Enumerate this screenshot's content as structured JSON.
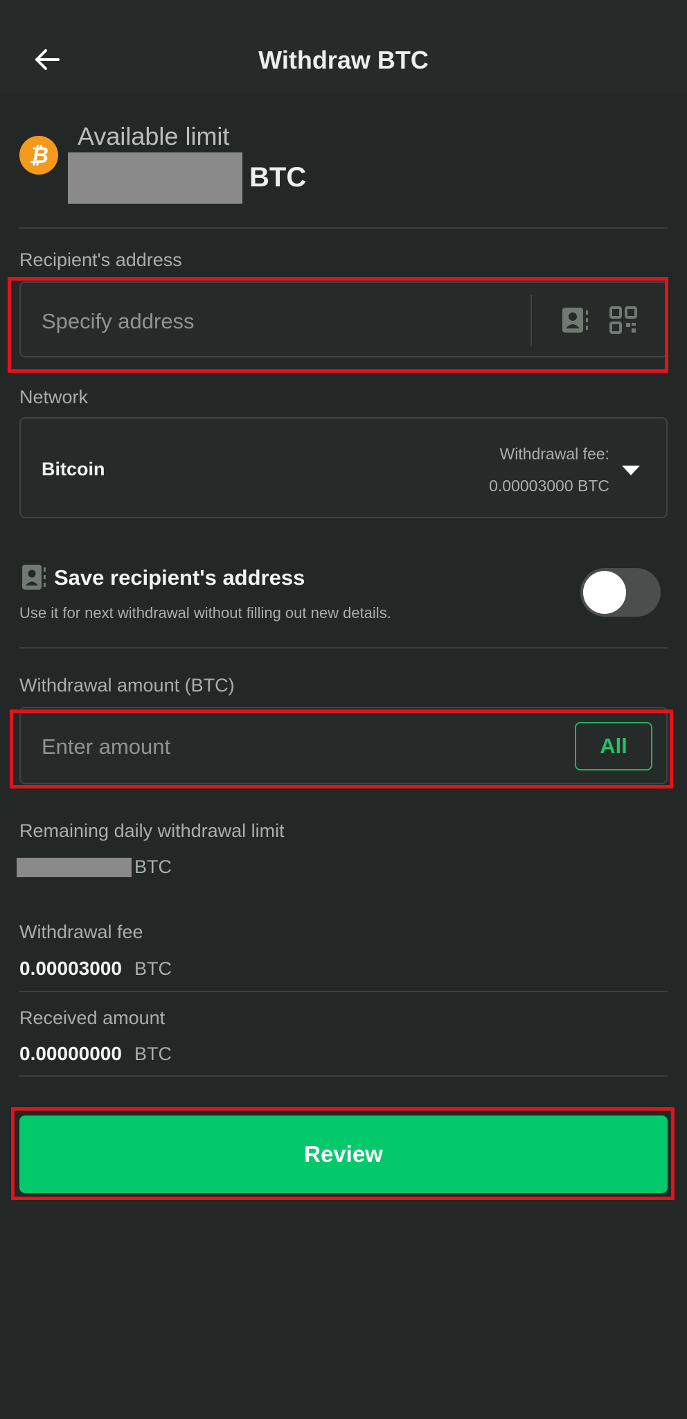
{
  "header": {
    "title": "Withdraw BTC",
    "back_icon": "arrow-left-icon"
  },
  "available": {
    "label": "Available limit",
    "unit": "BTC",
    "coin_icon": "bitcoin-icon"
  },
  "recipient": {
    "label": "Recipient's address",
    "placeholder": "Specify address",
    "contacts_icon": "address-book-icon",
    "qr_icon": "qr-scan-icon"
  },
  "network": {
    "label": "Network",
    "selected": "Bitcoin",
    "fee_label": "Withdrawal fee:",
    "fee_value": "0.00003000 BTC"
  },
  "save_address": {
    "title": "Save recipient's address",
    "description": "Use it for next withdrawal without filling out new details.",
    "enabled": false
  },
  "amount": {
    "label": "Withdrawal amount (BTC)",
    "placeholder": "Enter amount",
    "all_label": "All"
  },
  "remaining": {
    "label": "Remaining daily withdrawal limit",
    "unit": "BTC"
  },
  "withdrawal_fee": {
    "label": "Withdrawal fee",
    "value": "0.00003000",
    "unit": "BTC"
  },
  "received": {
    "label": "Received amount",
    "value": "0.00000000",
    "unit": "BTC"
  },
  "review": {
    "label": "Review"
  },
  "colors": {
    "accent": "#03c96a",
    "highlight": "#e1141c",
    "background": "#232726"
  }
}
